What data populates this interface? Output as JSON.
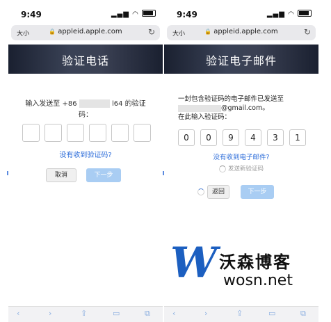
{
  "left": {
    "status_time": "9:49",
    "url_aa": "大小",
    "url_text": "appleid.apple.com",
    "title": "验证电话",
    "prompt_line1_prefix": "输入发送至 +86",
    "prompt_line1_suffix": "l64 的验证",
    "prompt_line2": "码：",
    "not_received_link": "没有收到验证码?",
    "cancel_label": "取消",
    "next_label": "下一步"
  },
  "right": {
    "status_time": "9:49",
    "url_aa": "大小",
    "url_text": "appleid.apple.com",
    "title": "验证电子邮件",
    "prompt_line1": "一封包含验证码的电子邮件已发送至",
    "prompt_line2_suffix": "@gmail.com。",
    "prompt_line3": "在此输入验证码：",
    "code_digits": [
      "0",
      "0",
      "9",
      "4",
      "3",
      "1"
    ],
    "not_received_link": "没有收到电子邮件?",
    "resend_label": "发送新验证码",
    "back_label": "返回",
    "next_label": "下一步"
  },
  "watermark": {
    "logo_letter": "W",
    "brand_cn": "沃森博客",
    "brand_en": "wosn.net"
  },
  "icons": {
    "toolbar": [
      "back-icon",
      "forward-icon",
      "share-icon",
      "bookmarks-icon",
      "tabs-icon"
    ],
    "reload": "reload-icon",
    "lock": "lock-icon"
  },
  "colors": {
    "link": "#2a6bd9",
    "primary_button_disabled": "#a9cdf3",
    "banner_dark": "#1a2030",
    "logo_blue": "#1c5fc0"
  }
}
